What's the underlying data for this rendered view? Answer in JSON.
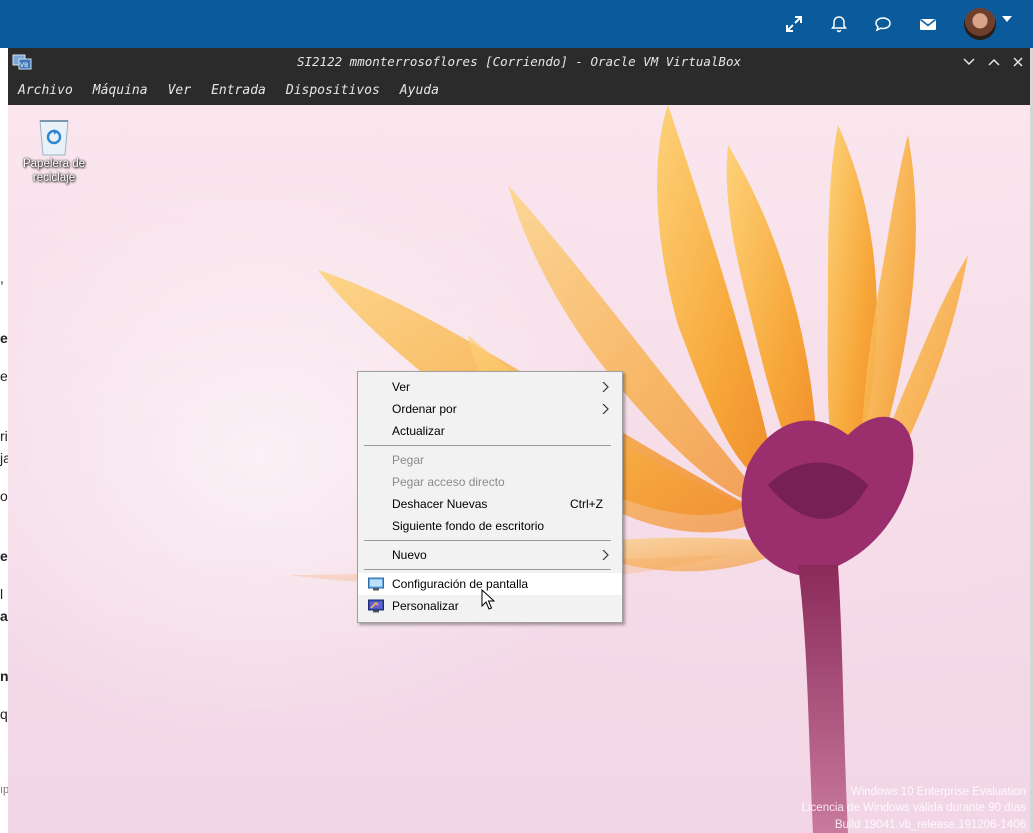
{
  "host": {
    "icons": [
      "expand-icon",
      "bell-icon",
      "chat-bubble-icon",
      "envelope-icon"
    ],
    "left_fragments": [
      ",",
      "e",
      "e",
      "ri",
      "ja",
      "o",
      "e",
      "l",
      "a",
      "n",
      "q",
      "ıp"
    ]
  },
  "vbox": {
    "title": "SI2122 mmonterrosoflores [Corriendo] - Oracle VM VirtualBox",
    "menu": [
      "Archivo",
      "Máquina",
      "Ver",
      "Entrada",
      "Dispositivos",
      "Ayuda"
    ]
  },
  "desktop": {
    "recycle_bin_label_1": "Papelera de",
    "recycle_bin_label_2": "reciclaje",
    "watermark": {
      "line1": "Windows 10 Enterprise Evaluation",
      "line2": "Licencia de Windows válida durante 90 días",
      "line3": "Build 19041.vb_release.191206-1406"
    }
  },
  "context_menu": {
    "view": "Ver",
    "sort_by": "Ordenar por",
    "refresh": "Actualizar",
    "paste": "Pegar",
    "paste_shortcut": "Pegar acceso directo",
    "undo_new": "Deshacer Nuevas",
    "undo_new_shortcut": "Ctrl+Z",
    "next_wallpaper": "Siguiente fondo de escritorio",
    "new": "Nuevo",
    "display_settings": "Configuración de pantalla",
    "personalize": "Personalizar"
  },
  "colors": {
    "host_bar": "#0b5a9b",
    "vbox_chrome": "#2b2b2b",
    "menu_bg": "#f2f2f2",
    "petal_orange": "#f7a83a"
  }
}
